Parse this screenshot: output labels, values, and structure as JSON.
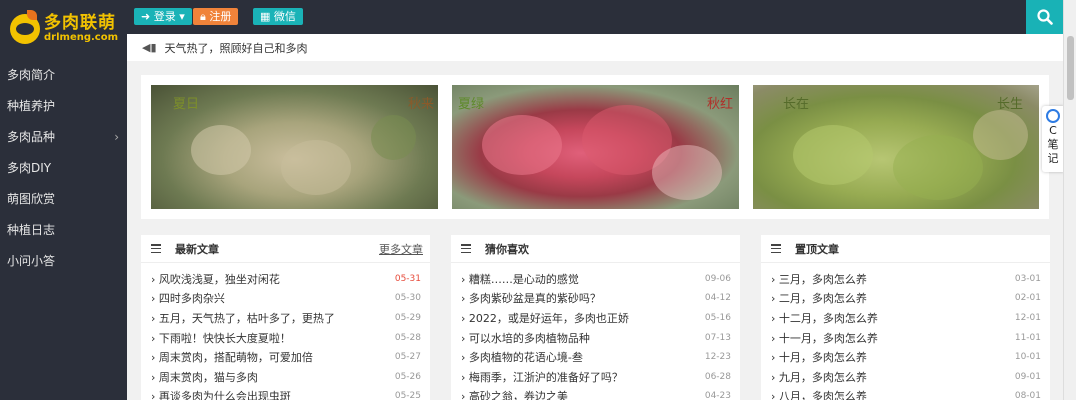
{
  "logo": {
    "name": "多肉联萌",
    "domain": "drlmeng.com"
  },
  "nav": [
    {
      "label": "多肉简介",
      "has_sub": false
    },
    {
      "label": "种植养护",
      "has_sub": false
    },
    {
      "label": "多肉品种",
      "has_sub": true
    },
    {
      "label": "多肉DIY",
      "has_sub": false
    },
    {
      "label": "萌图欣赏",
      "has_sub": false
    },
    {
      "label": "种植日志",
      "has_sub": false
    },
    {
      "label": "小问小答",
      "has_sub": false
    }
  ],
  "nav_chevron": "›",
  "topbar": {
    "login_label": "登录",
    "register_label": "注册",
    "wechat_label": "微信"
  },
  "notice": {
    "text": "天气热了，照顾好自己和多肉"
  },
  "float_widget": {
    "lines": [
      "C",
      "笔",
      "记"
    ]
  },
  "banner": {
    "images": [
      {
        "cap_left": "夏日",
        "cap_right": "秋来"
      },
      {
        "cap_left": "夏绿",
        "cap_right": "秋红"
      },
      {
        "cap_left": "长在",
        "cap_right": "长生"
      }
    ]
  },
  "cards": [
    {
      "title": "最新文章",
      "more": "更多文章",
      "articles": [
        {
          "title": "风吹浅浅夏，独坐对闲花",
          "date": "05-31",
          "hot": true
        },
        {
          "title": "四时多肉杂兴",
          "date": "05-30",
          "hot": false
        },
        {
          "title": "五月，天气热了，枯叶多了，更热了",
          "date": "05-29",
          "hot": false
        },
        {
          "title": "下雨啦！快快长大度夏啦！",
          "date": "05-28",
          "hot": false
        },
        {
          "title": "周末赏肉，搭配萌物，可爱加倍",
          "date": "05-27",
          "hot": false
        },
        {
          "title": "周末赏肉，猫与多肉",
          "date": "05-26",
          "hot": false
        },
        {
          "title": "再谈多肉为什么会出现虫斑",
          "date": "05-25",
          "hot": false
        }
      ]
    },
    {
      "title": "猜你喜欢",
      "more": "",
      "articles": [
        {
          "title": "糟糕……是心动的感觉",
          "date": "09-06",
          "hot": false
        },
        {
          "title": "多肉紫砂盆是真的紫砂吗？",
          "date": "04-12",
          "hot": false
        },
        {
          "title": "2022，或是好运年，多肉也正娇",
          "date": "05-16",
          "hot": false
        },
        {
          "title": "可以水培的多肉植物品种",
          "date": "07-13",
          "hot": false
        },
        {
          "title": "多肉植物的花语心境-叁",
          "date": "12-23",
          "hot": false
        },
        {
          "title": "梅雨季，江浙沪的准备好了吗？",
          "date": "06-28",
          "hot": false
        },
        {
          "title": "高砂之翁，券边之美",
          "date": "04-23",
          "hot": false
        }
      ]
    },
    {
      "title": "置顶文章",
      "more": "",
      "articles": [
        {
          "title": "三月，多肉怎么养",
          "date": "03-01",
          "hot": false
        },
        {
          "title": "二月，多肉怎么养",
          "date": "02-01",
          "hot": false
        },
        {
          "title": "十二月，多肉怎么养",
          "date": "12-01",
          "hot": false
        },
        {
          "title": "十一月，多肉怎么养",
          "date": "11-01",
          "hot": false
        },
        {
          "title": "十月，多肉怎么养",
          "date": "10-01",
          "hot": false
        },
        {
          "title": "九月，多肉怎么养",
          "date": "09-01",
          "hot": false
        },
        {
          "title": "八月，多肉怎么养",
          "date": "08-01",
          "hot": false
        }
      ]
    }
  ],
  "article_prefix": "› ",
  "colors": {
    "sidebar_bg": "#2b2f3a",
    "accent_teal": "#1ab3b7",
    "accent_orange": "#f0833a",
    "logo_yellow": "#f2c200",
    "hot_date": "#e74c3c"
  }
}
